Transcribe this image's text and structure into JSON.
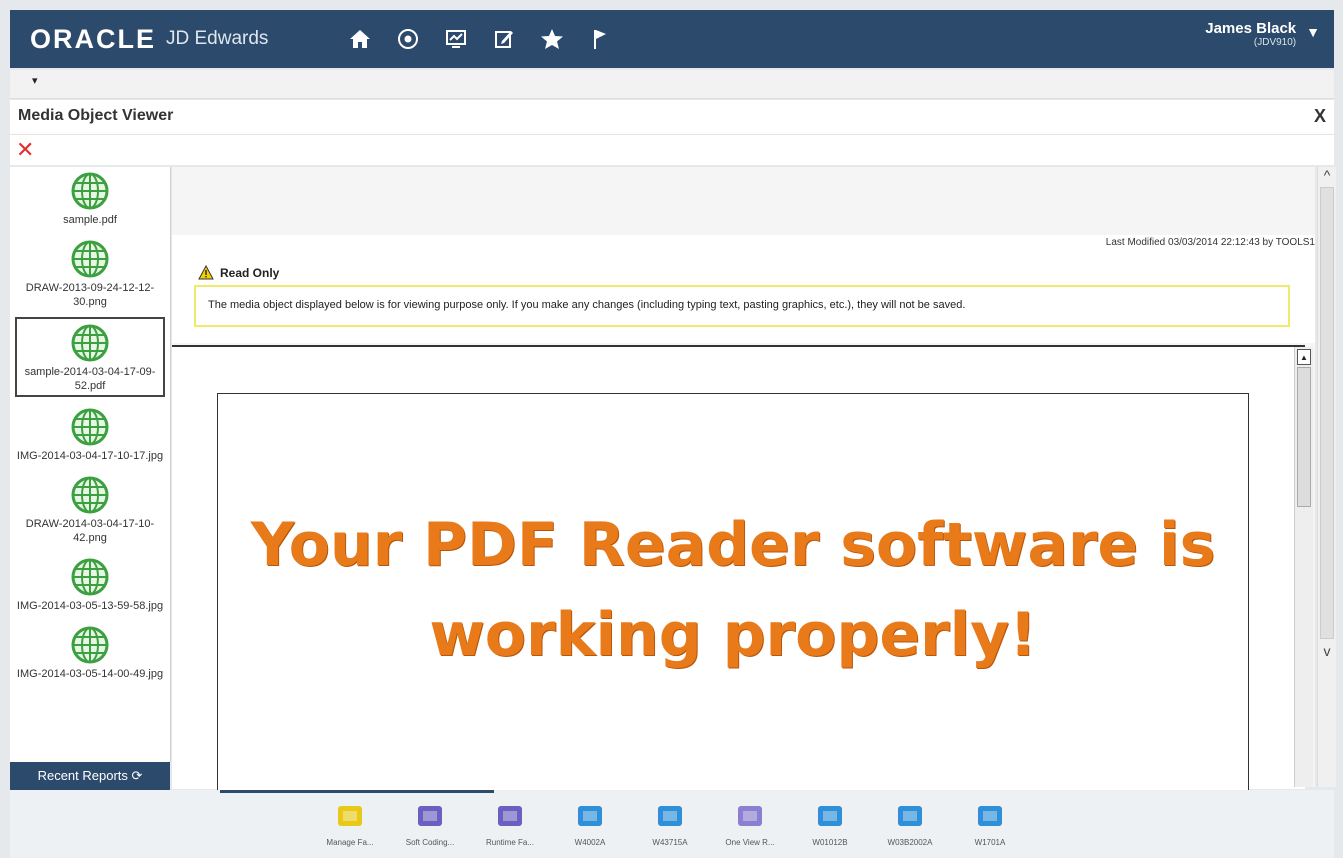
{
  "header": {
    "brand": "ORACLE",
    "product": "JD Edwards",
    "user_name": "James Black",
    "user_id": "(JDV910)",
    "nav_icons": [
      "home-icon",
      "recent-icon",
      "dashboard-icon",
      "edit-icon",
      "favorites-icon",
      "flag-icon"
    ]
  },
  "window": {
    "title": "Media Object Viewer",
    "close_label": "X",
    "delete_label": "✕"
  },
  "sidebar": {
    "files": [
      {
        "name": "sample.pdf"
      },
      {
        "name": "DRAW-2013-09-24-12-12-30.png"
      },
      {
        "name": "sample-2014-03-04-17-09-52.pdf"
      },
      {
        "name": "IMG-2014-03-04-17-10-17.jpg"
      },
      {
        "name": "DRAW-2014-03-04-17-10-42.png"
      },
      {
        "name": "IMG-2014-03-05-13-59-58.jpg"
      },
      {
        "name": "IMG-2014-03-05-14-00-49.jpg"
      }
    ],
    "recent_reports": "Recent Reports ⟳"
  },
  "viewer": {
    "last_modified": "Last Modified 03/03/2014 22:12:43 by TOOLS1",
    "read_only_label": "Read Only",
    "read_only_message": "The media object displayed below is for viewing purpose only. If you make any changes (including typing text, pasting graphics, etc.), they will not be saved.",
    "pdf_line1": "Your PDF Reader software is",
    "pdf_line2": "working properly!"
  },
  "taskbar": {
    "items": [
      {
        "label": "Manage Fa...",
        "icon": "star-search-icon",
        "color": "#e8c91a"
      },
      {
        "label": "Soft Coding...",
        "icon": "folder-icon",
        "color": "#6b5fbf"
      },
      {
        "label": "Runtime Fa...",
        "icon": "folder-icon",
        "color": "#6b5fbf"
      },
      {
        "label": "W4002A",
        "icon": "cycle-icon",
        "color": "#2f8fd8"
      },
      {
        "label": "W43715A",
        "icon": "factory-icon",
        "color": "#2f8fd8"
      },
      {
        "label": "One View R...",
        "icon": "folder-report-icon",
        "color": "#8a7fd0"
      },
      {
        "label": "W01012B",
        "icon": "people-icon",
        "color": "#2f8fd8"
      },
      {
        "label": "W03B2002A",
        "icon": "calculator-icon",
        "color": "#2f8fd8"
      },
      {
        "label": "W1701A",
        "icon": "user-gear-icon",
        "color": "#2f8fd8"
      }
    ]
  }
}
